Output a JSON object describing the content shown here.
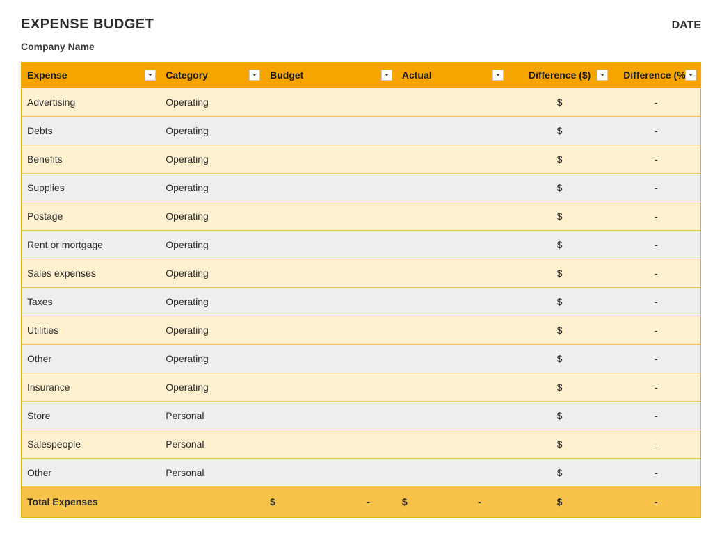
{
  "header": {
    "title": "EXPENSE BUDGET",
    "date_label": "DATE",
    "company": "Company Name"
  },
  "columns": {
    "expense": "Expense",
    "category": "Category",
    "budget": "Budget",
    "actual": "Actual",
    "diff_dollar": "Difference ($)",
    "diff_percent": "Difference (%)"
  },
  "rows": [
    {
      "expense": "Advertising",
      "category": "Operating",
      "budget": "",
      "actual": "",
      "diff_dollar": "$",
      "diff_percent": "-"
    },
    {
      "expense": "Debts",
      "category": "Operating",
      "budget": "",
      "actual": "",
      "diff_dollar": "$",
      "diff_percent": "-"
    },
    {
      "expense": "Benefits",
      "category": "Operating",
      "budget": "",
      "actual": "",
      "diff_dollar": "$",
      "diff_percent": "-"
    },
    {
      "expense": "Supplies",
      "category": "Operating",
      "budget": "",
      "actual": "",
      "diff_dollar": "$",
      "diff_percent": "-"
    },
    {
      "expense": "Postage",
      "category": "Operating",
      "budget": "",
      "actual": "",
      "diff_dollar": "$",
      "diff_percent": "-"
    },
    {
      "expense": "Rent or mortgage",
      "category": "Operating",
      "budget": "",
      "actual": "",
      "diff_dollar": "$",
      "diff_percent": "-"
    },
    {
      "expense": "Sales expenses",
      "category": "Operating",
      "budget": "",
      "actual": "",
      "diff_dollar": "$",
      "diff_percent": "-"
    },
    {
      "expense": "Taxes",
      "category": "Operating",
      "budget": "",
      "actual": "",
      "diff_dollar": "$",
      "diff_percent": "-"
    },
    {
      "expense": "Utilities",
      "category": "Operating",
      "budget": "",
      "actual": "",
      "diff_dollar": "$",
      "diff_percent": "-"
    },
    {
      "expense": "Other",
      "category": "Operating",
      "budget": "",
      "actual": "",
      "diff_dollar": "$",
      "diff_percent": "-"
    },
    {
      "expense": "Insurance",
      "category": "Operating",
      "budget": "",
      "actual": "",
      "diff_dollar": "$",
      "diff_percent": "-"
    },
    {
      "expense": "Store",
      "category": "Personal",
      "budget": "",
      "actual": "",
      "diff_dollar": "$",
      "diff_percent": "-"
    },
    {
      "expense": "Salespeople",
      "category": "Personal",
      "budget": "",
      "actual": "",
      "diff_dollar": "$",
      "diff_percent": "-"
    },
    {
      "expense": "Other",
      "category": "Personal",
      "budget": "",
      "actual": "",
      "diff_dollar": "$",
      "diff_percent": "-"
    }
  ],
  "total": {
    "label": "Total Expenses",
    "budget_sym": "$",
    "budget_val": "-",
    "actual_sym": "$",
    "actual_val": "-",
    "diff_dollar": "$",
    "diff_percent": "-"
  }
}
